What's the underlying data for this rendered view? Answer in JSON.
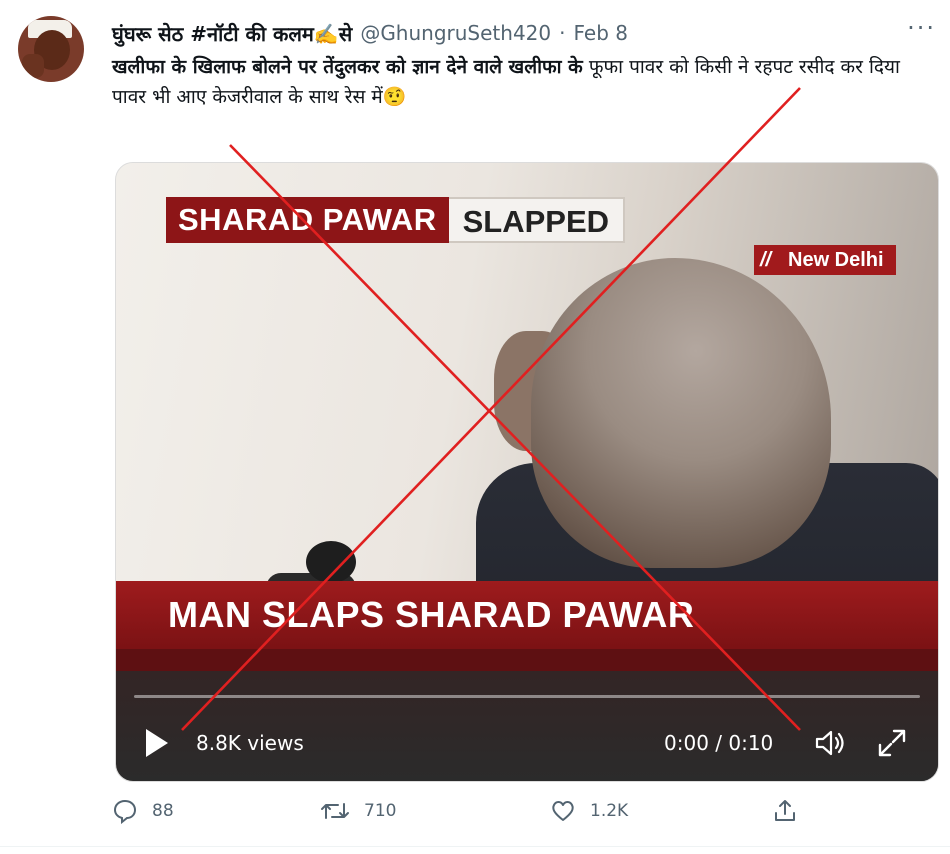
{
  "tweet": {
    "author_name": "घुंघरू सेठ #नॉटी की कलम✍️से",
    "handle": "@GhungruSeth420",
    "separator": "·",
    "date": "Feb 8",
    "more_label": "···",
    "text_bold": "खलीफा के खिलाफ बोलने पर तेंदुलकर को ज्ञान देने वाले खलीफा के",
    "text_rest": " फूफा पावर को किसी ने रहपट रसीद कर दिया",
    "text_line2": "पावर भी आए केजरीवाल के साथ रेस में🤨"
  },
  "video": {
    "banner_red": "SHARAD PAWAR",
    "banner_white": "SLAPPED",
    "location": "New Delhi",
    "ticker": "MAN SLAPS SHARAD PAWAR",
    "views": "8.8K views",
    "time": "0:00 / 0:10",
    "progress": 0
  },
  "actions": {
    "replies": "88",
    "retweets": "710",
    "likes": "1.2K"
  },
  "colors": {
    "cross": "#e02020",
    "banner_red": "#8d1517",
    "muted": "#536471"
  }
}
